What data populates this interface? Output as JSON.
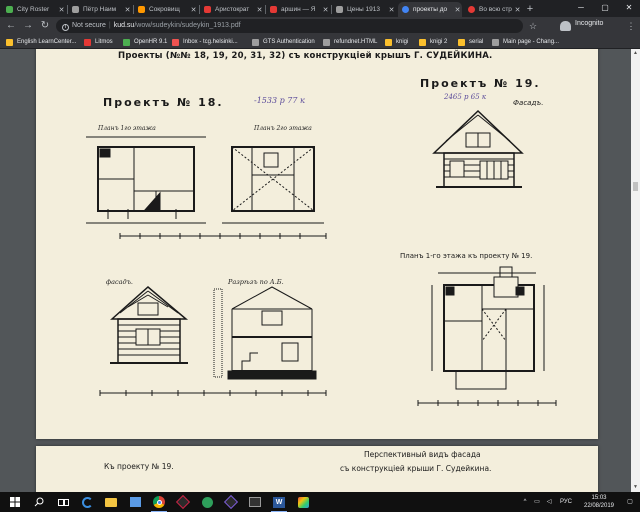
{
  "browser": {
    "tabs": [
      {
        "title": "City Roster",
        "color": "#4caf50"
      },
      {
        "title": "Пётр Наим",
        "color": "#9e9e9e"
      },
      {
        "title": "Сокровищ",
        "color": "#ff9800"
      },
      {
        "title": "Аристократ",
        "color": "#e53935"
      },
      {
        "title": "аршин — Я",
        "color": "#e53935"
      },
      {
        "title": "Цены 1913",
        "color": "#9e9e9e"
      },
      {
        "title": "проекты до",
        "color": "#4285f4"
      },
      {
        "title": "Во всю стр",
        "color": "#e53935"
      }
    ],
    "new_tab": "+",
    "window_controls": {
      "minimize": "─",
      "maximize": "▢",
      "close": "✕"
    },
    "nav": {
      "back": "←",
      "forward": "→",
      "reload": "↻"
    },
    "address": {
      "security": "Not secure",
      "host": "kud.su",
      "path": "/wow/sudeykin/sudeykin_1913.pdf"
    },
    "incognito_label": "Incognito",
    "bookmarks": [
      {
        "label": "English LearnCenter...",
        "color": "#fbc02d"
      },
      {
        "label": "Litmos",
        "color": "#e53935"
      },
      {
        "label": "OpenHR 9.1",
        "color": "#4caf50"
      },
      {
        "label": "Inbox - tcg.helsinki...",
        "color": "#ef5350"
      },
      {
        "label": "GTS Authentication",
        "color": "#9e9e9e"
      },
      {
        "label": "refundnet.HTML",
        "color": "#9e9e9e"
      },
      {
        "label": "knigi",
        "color": "#fbc02d"
      },
      {
        "label": "knigi 2",
        "color": "#fbc02d"
      },
      {
        "label": "serial",
        "color": "#fbc02d"
      },
      {
        "label": "Main page - Chang...",
        "color": "#9e9e9e"
      }
    ]
  },
  "document": {
    "page1": {
      "header": "Проекты (№№ 18, 19, 20, 31, 32) съ конструкціей крышъ Г. СУДЕЙКИНА.",
      "project18_title": "Проектъ № 18.",
      "project18_note": "-1533 р 77 к",
      "project19_title": "Проектъ № 19.",
      "project19_note": "2465 р 65 к",
      "facade_label": "Фасадъ.",
      "plan1_label": "Планъ 1го этажа",
      "plan2_label": "Планъ 2го этажа",
      "facade18_label": "фасадъ.",
      "section_label": "Разрѣзъ по А.Б.",
      "plan19_label": "Планъ 1-го этажа къ проекту № 19."
    },
    "page2": {
      "left": "Къ проекту № 19.",
      "right_line1": "Перспективный видъ фасада",
      "right_line2": "съ конструкціей крыши Г. Судейкина."
    }
  },
  "taskbar": {
    "lang": "РУС",
    "time": "15:03",
    "date": "22/08/2019"
  }
}
